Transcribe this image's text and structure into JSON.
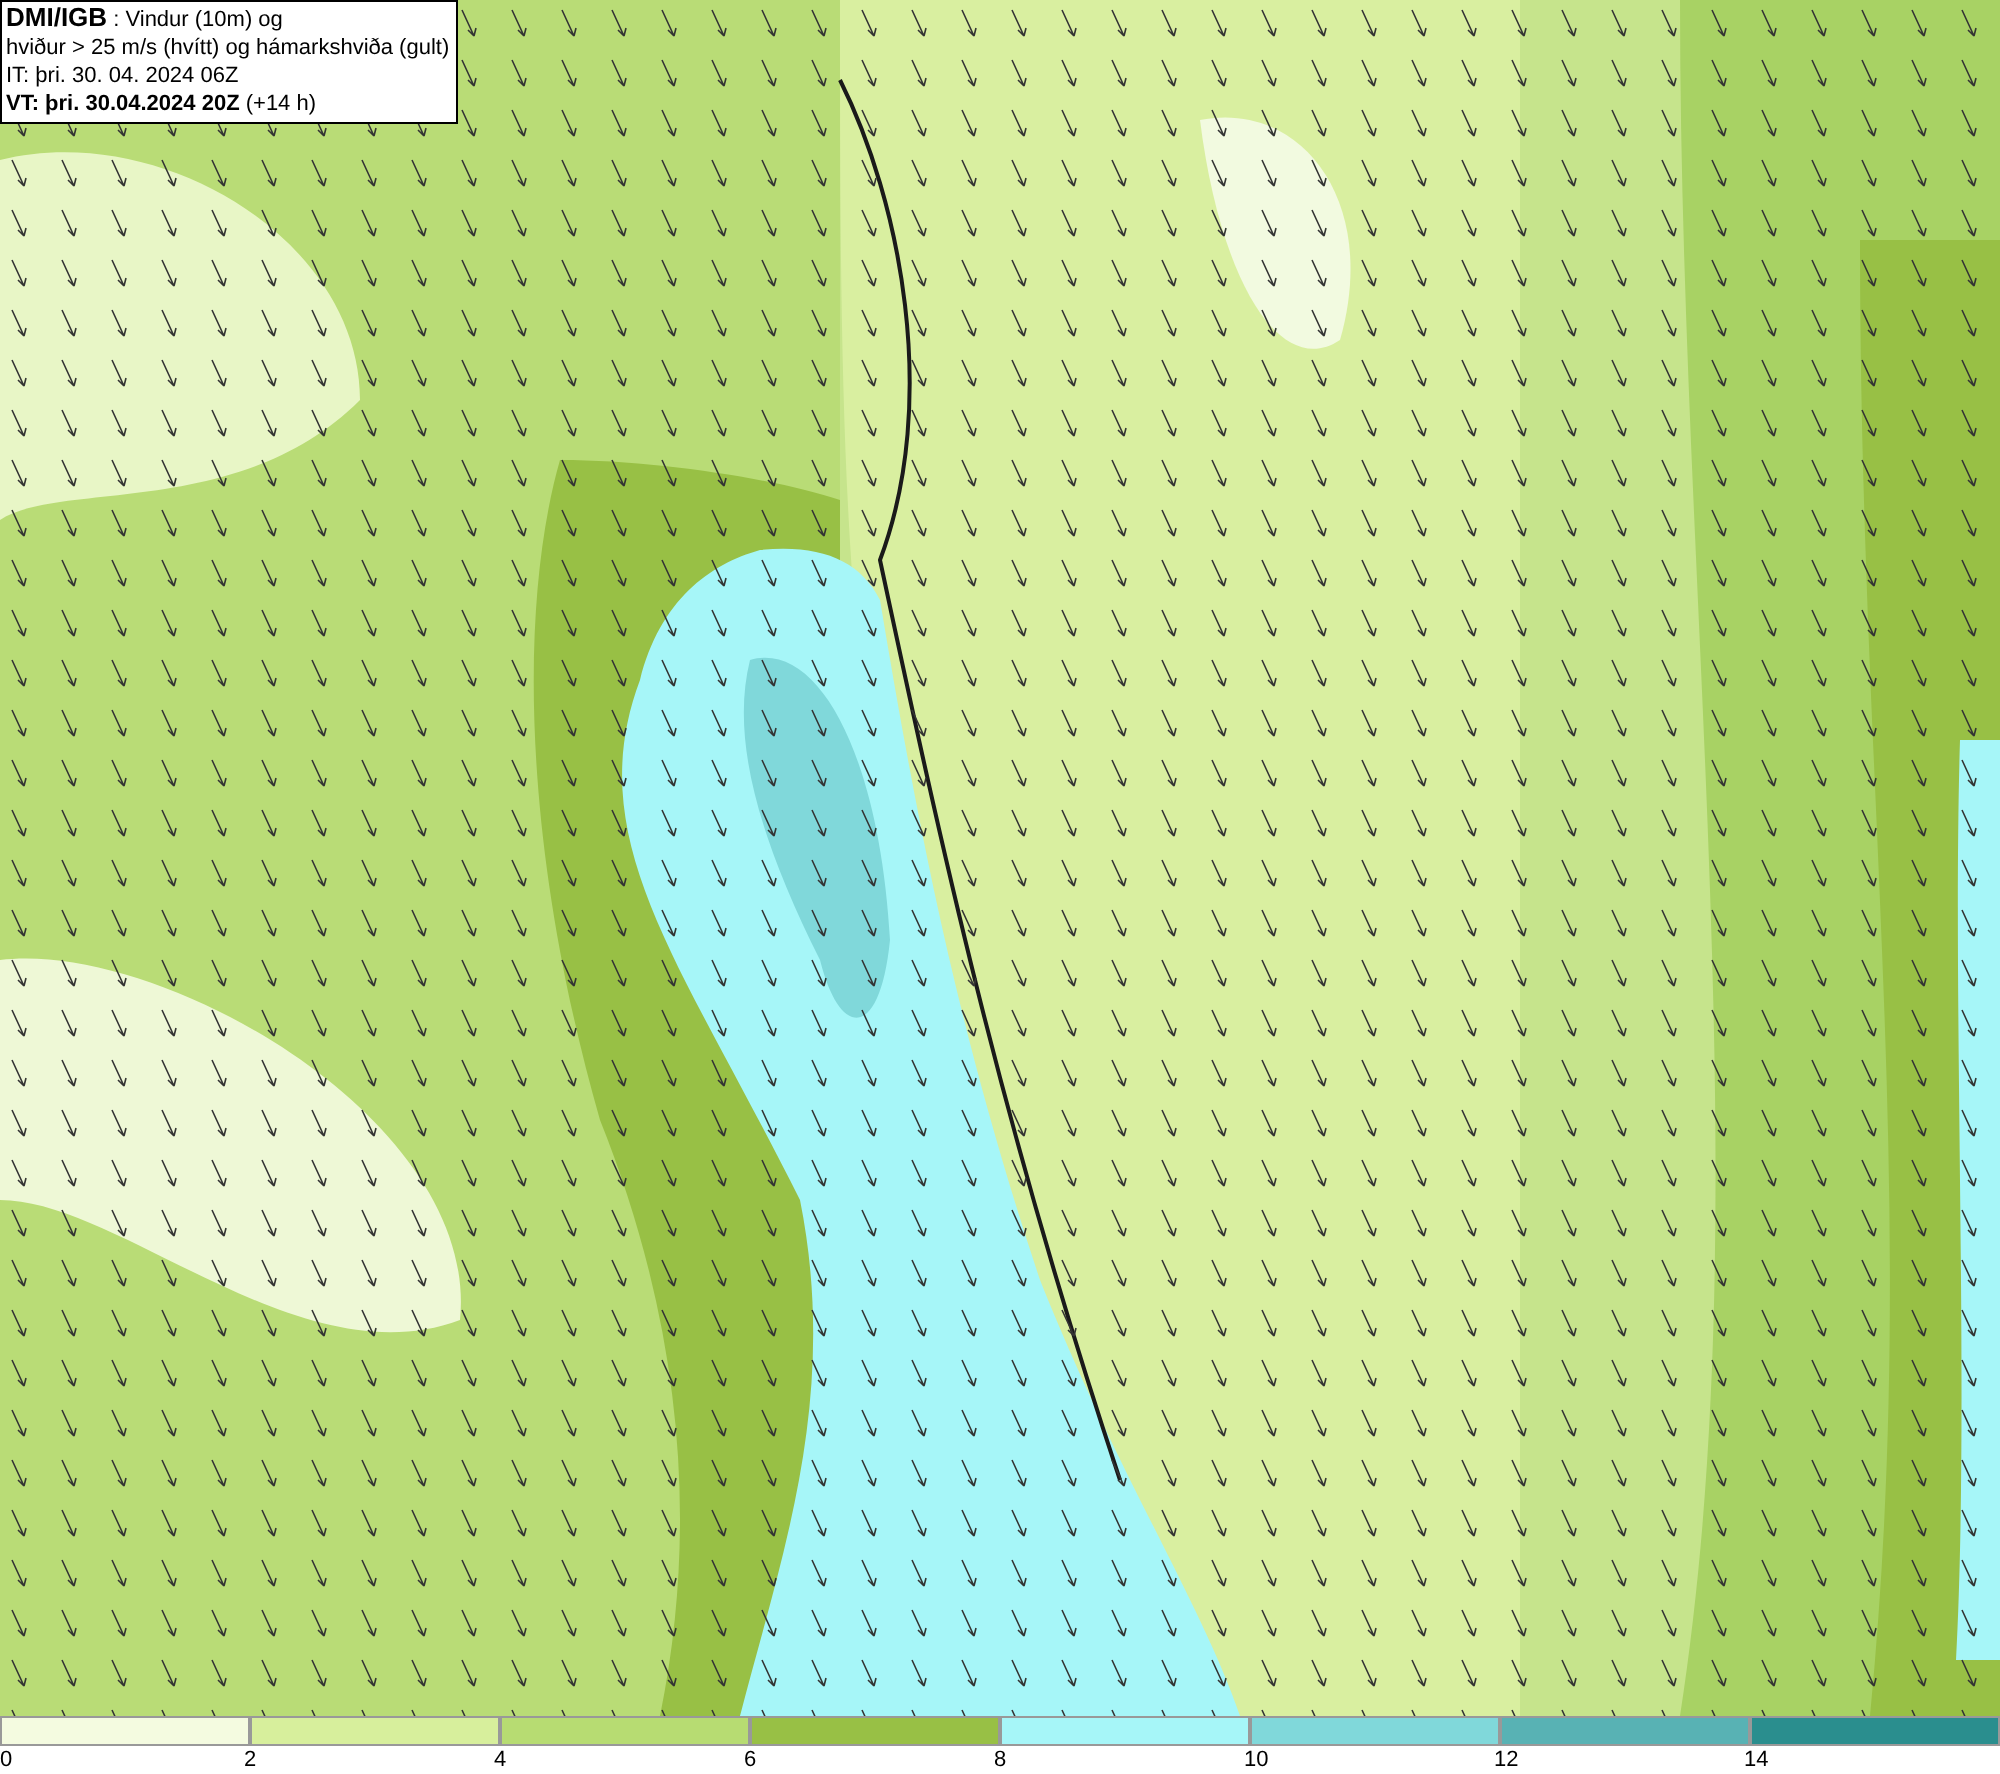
{
  "legend": {
    "lines": [
      "**DMI/IGB** : Vindur (10m) og",
      "hviður > 25 m/s (hvítt) og hámarkshviða (gult)",
      "IT: þri. 30. 04. 2024 06Z",
      "**VT: þri. 30.04.2024 20Z** (+14 h)"
    ]
  },
  "colorbar": {
    "bins": [
      {
        "color": "#f4fbe0"
      },
      {
        "color": "#d7ef9c"
      },
      {
        "color": "#b7dc72"
      },
      {
        "color": "#98c045"
      },
      {
        "color": "#a6f6f8"
      },
      {
        "color": "#80d8da"
      },
      {
        "color": "#58b2b4"
      },
      {
        "color": "#2a8e8e"
      }
    ],
    "labels": [
      "0",
      "2",
      "4",
      "6",
      "8",
      "10",
      "12",
      "14"
    ]
  }
}
